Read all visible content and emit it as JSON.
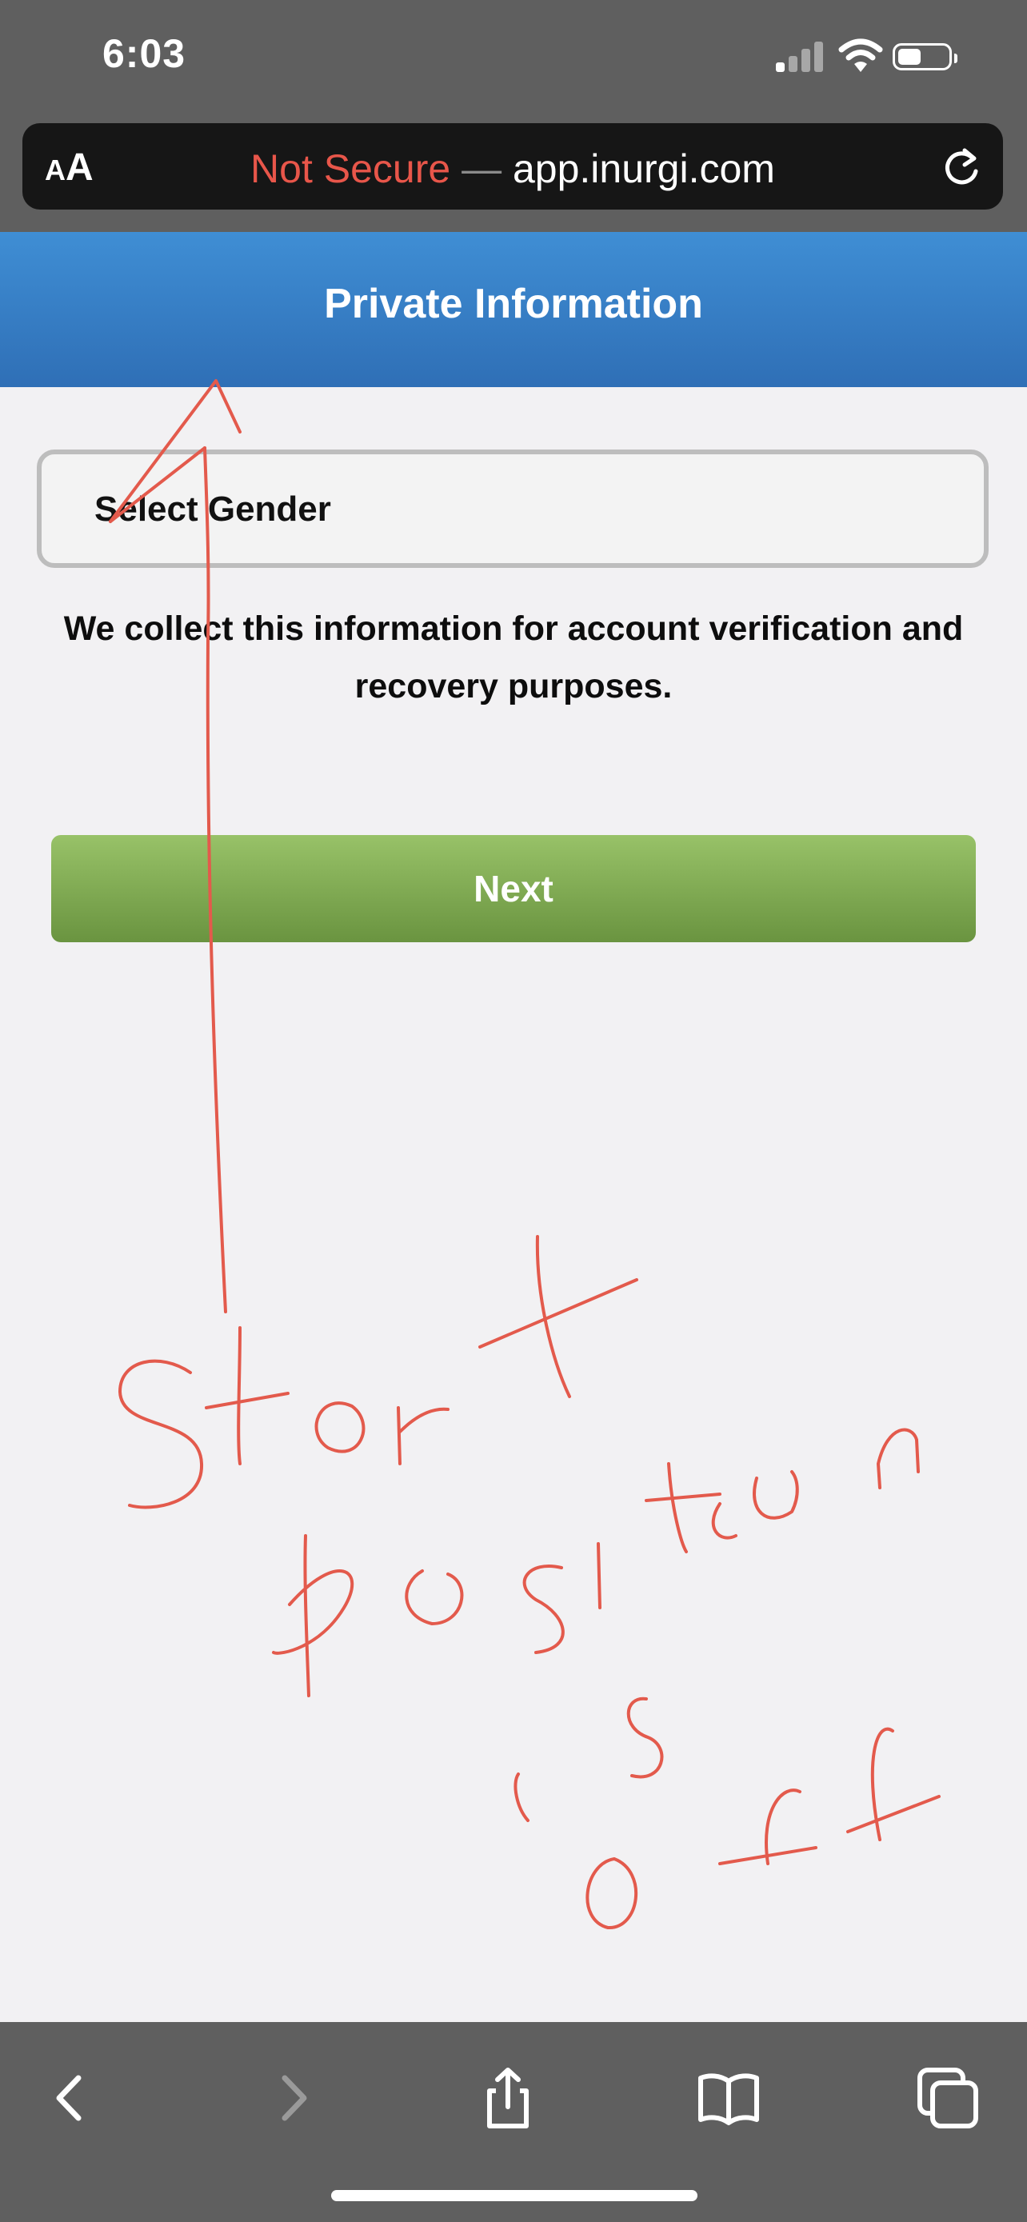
{
  "status_bar": {
    "time": "6:03",
    "signal_icon": "cellular-signal-icon",
    "wifi_icon": "wifi-icon",
    "battery_icon": "battery-icon",
    "battery_level": 0.45
  },
  "browser": {
    "aa_small": "A",
    "aa_big": "A",
    "security_label": "Not Secure",
    "separator": "—",
    "domain": "app.inurgi.com",
    "reload_icon": "reload-icon",
    "colors": {
      "warning": "#e8564a",
      "bar": "#161616",
      "chrome": "#5f5f5f"
    }
  },
  "page": {
    "title": "Private Information",
    "gender_select": {
      "selected": "Select Gender"
    },
    "info_text": "We collect this information for account verification and recovery purposes.",
    "next_label": "Next",
    "colors": {
      "header": "#3478c4",
      "next_button": "#7fab52",
      "background": "#f2f1f3"
    }
  },
  "annotation": {
    "text": "Start position is off",
    "color": "#e35a4c"
  },
  "toolbar": {
    "back_icon": "chevron-left-icon",
    "forward_icon": "chevron-right-icon",
    "share_icon": "share-icon",
    "bookmarks_icon": "book-icon",
    "tabs_icon": "tabs-icon"
  }
}
